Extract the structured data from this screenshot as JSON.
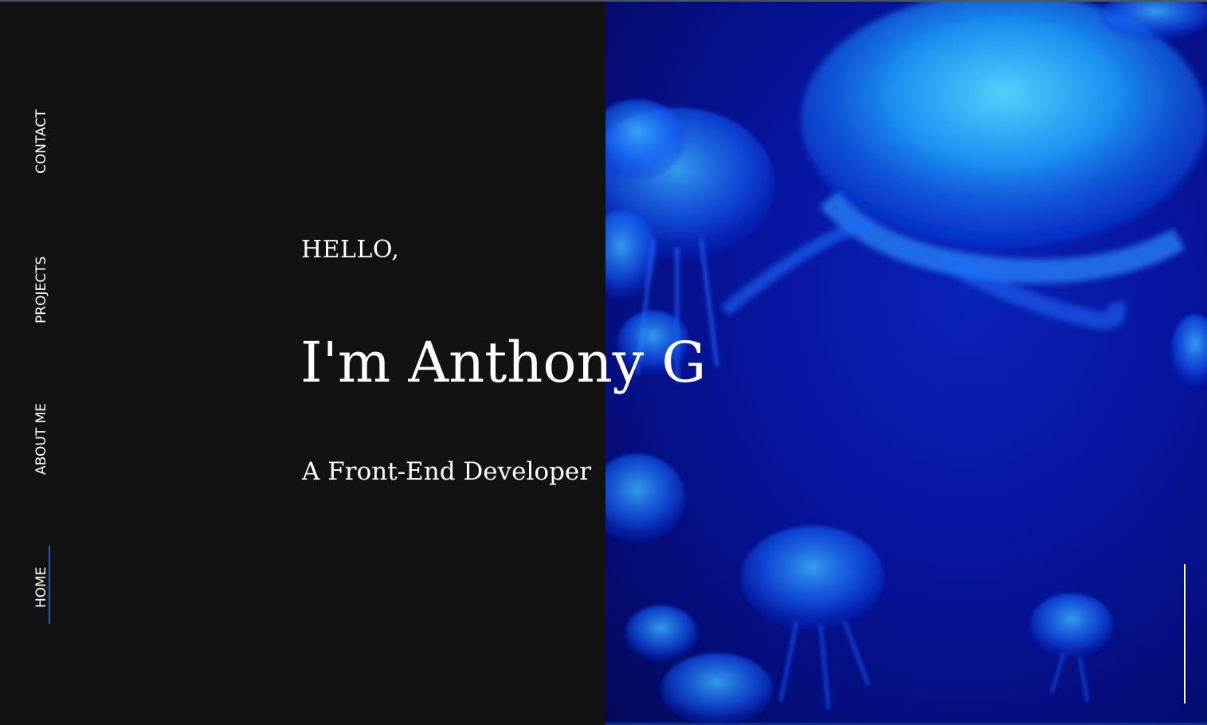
{
  "nav": {
    "items": [
      {
        "label": "CONTACT"
      },
      {
        "label": "PROJECTS"
      },
      {
        "label": "ABOUT ME"
      },
      {
        "label": "HOME"
      }
    ],
    "active": "HOME"
  },
  "hero": {
    "greeting": "HELLO,",
    "name": "I'm Anthony G",
    "role": "A Front-End Developer"
  },
  "background": {
    "image": "jellyfish-icon",
    "colors": {
      "panel_dark": "#121212",
      "accent_blue": "#1f5fc4",
      "water_blue": "#0715a0",
      "jelly_cyan": "#1fb8ff"
    }
  }
}
